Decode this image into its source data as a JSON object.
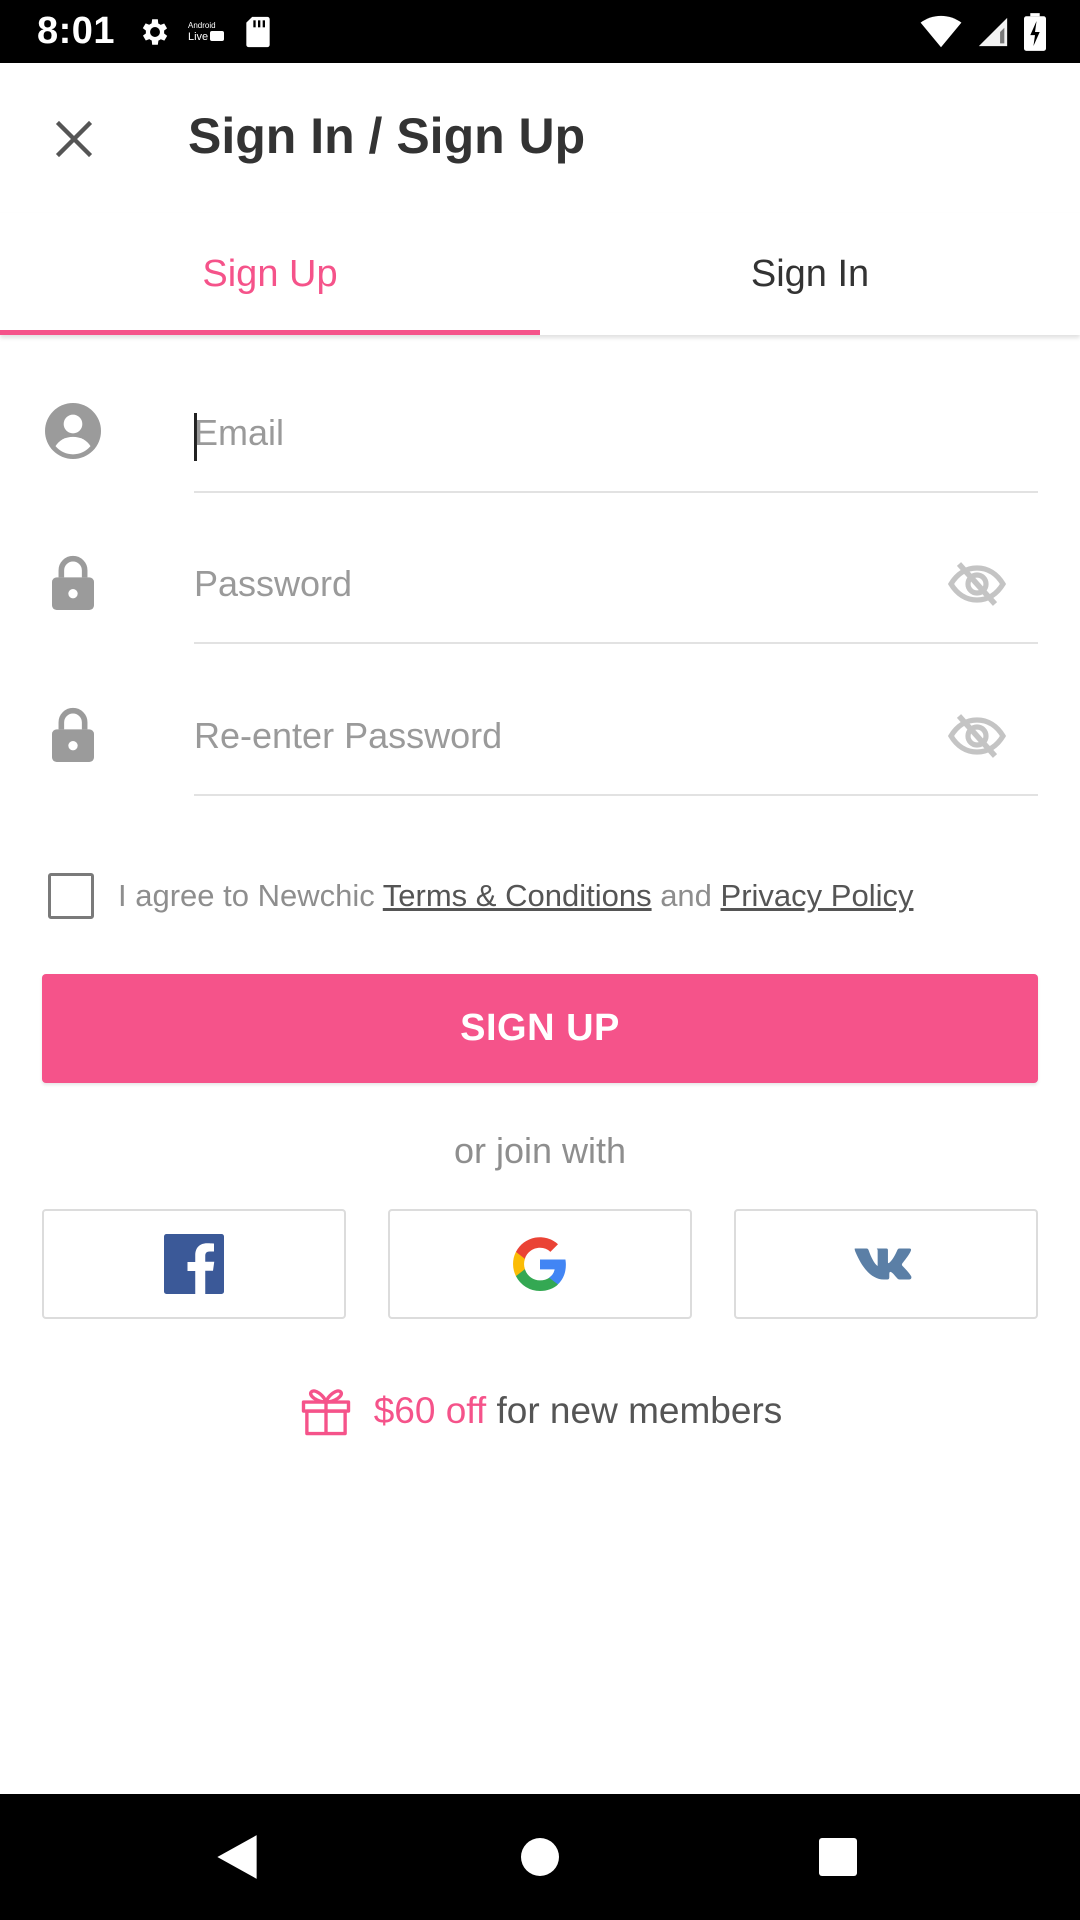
{
  "status_bar": {
    "time": "8:01",
    "left_icons": [
      "settings-icon",
      "android-live-icon",
      "sd-card-icon"
    ],
    "right_icons": [
      "wifi-icon",
      "signal-icon",
      "battery-charging-icon"
    ]
  },
  "toolbar": {
    "close_icon": "close-icon",
    "title": "Sign In / Sign Up"
  },
  "tabs": [
    {
      "label": "Sign Up",
      "active": true
    },
    {
      "label": "Sign In",
      "active": false
    }
  ],
  "form": {
    "email": {
      "placeholder": "Email",
      "icon": "account-circle-icon"
    },
    "password": {
      "placeholder": "Password",
      "icon": "lock-icon",
      "toggle_icon": "visibility-off-icon"
    },
    "confirm_password": {
      "placeholder": "Re-enter Password",
      "icon": "lock-icon",
      "toggle_icon": "visibility-off-icon"
    }
  },
  "agreement": {
    "prefix": "I agree to Newchic ",
    "terms_link": "Terms & Conditions",
    "conjunction": " and ",
    "privacy_link": "Privacy Policy",
    "checked": false
  },
  "signup_button": "SIGN UP",
  "join_text": "or join with",
  "social": [
    {
      "name": "facebook",
      "icon": "facebook-icon",
      "color": "#3b5998"
    },
    {
      "name": "google",
      "icon": "google-icon",
      "color": "#4285f4"
    },
    {
      "name": "vk",
      "icon": "vk-icon",
      "color": "#5b7fa6"
    }
  ],
  "promo": {
    "icon": "gift-icon",
    "accent": "$60 off",
    "rest": "for new members"
  },
  "nav": [
    "back-icon",
    "home-icon",
    "recents-icon"
  ],
  "colors": {
    "accent": "#f5538a",
    "status_bar": "#000000",
    "text_gray": "#8e8e8e"
  }
}
